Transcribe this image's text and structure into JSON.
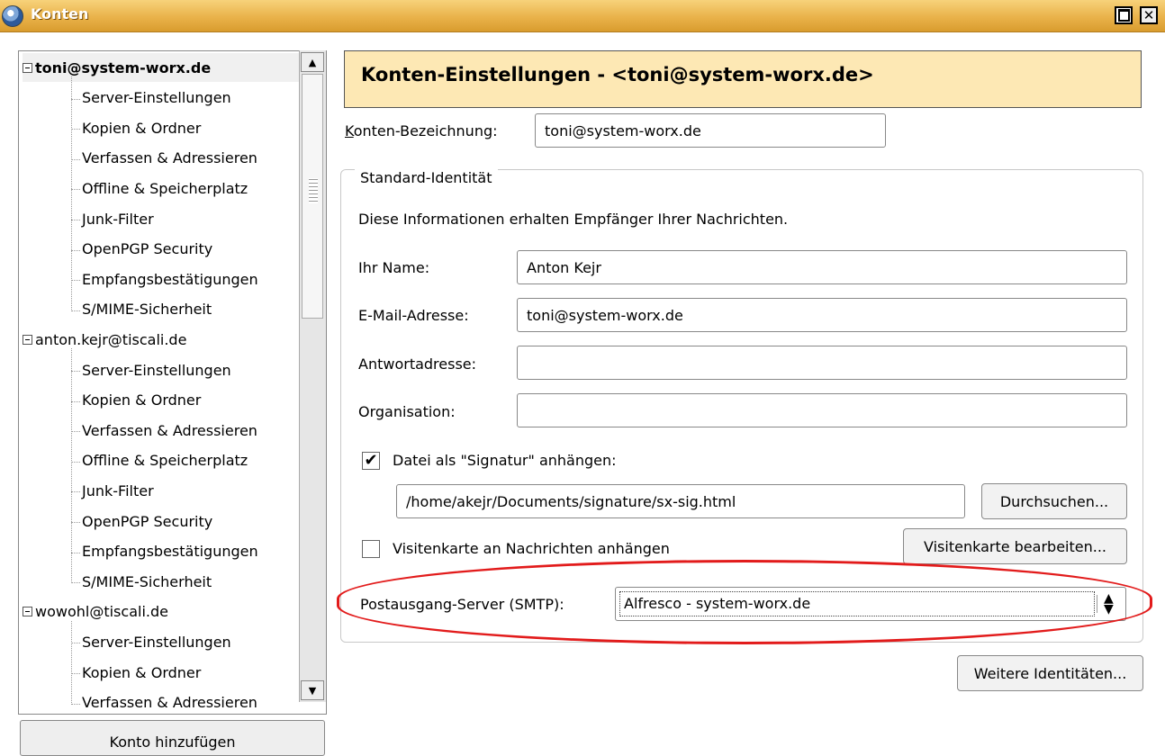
{
  "window": {
    "title": "Konten"
  },
  "tree": {
    "accounts": [
      {
        "name": "toni@system-worx.de",
        "selected": true,
        "children": [
          "Server-Einstellungen",
          "Kopien & Ordner",
          "Verfassen & Adressieren",
          "Offline & Speicherplatz",
          "Junk-Filter",
          "OpenPGP Security",
          "Empfangsbestätigungen",
          "S/MIME-Sicherheit"
        ]
      },
      {
        "name": "anton.kejr@tiscali.de",
        "selected": false,
        "children": [
          "Server-Einstellungen",
          "Kopien & Ordner",
          "Verfassen & Adressieren",
          "Offline & Speicherplatz",
          "Junk-Filter",
          "OpenPGP Security",
          "Empfangsbestätigungen",
          "S/MIME-Sicherheit"
        ]
      },
      {
        "name": "wowohl@tiscali.de",
        "selected": false,
        "children": [
          "Server-Einstellungen",
          "Kopien & Ordner",
          "Verfassen & Adressieren"
        ]
      }
    ],
    "add_account_label": "Konto hinzufügen"
  },
  "main": {
    "header": "Konten-Einstellungen - <toni@system-worx.de>",
    "account_name": {
      "label": "Konten-Bezeichnung:",
      "value": "toni@system-worx.de"
    },
    "identity": {
      "legend": "Standard-Identität",
      "info": "Diese Informationen erhalten Empfänger Ihrer Nachrichten.",
      "name": {
        "label": "Ihr Name:",
        "value": "Anton Kejr"
      },
      "email": {
        "label": "E-Mail-Adresse:",
        "value": "toni@system-worx.de"
      },
      "reply_to": {
        "label": "Antwortadresse:",
        "value": ""
      },
      "organization": {
        "label": "Organisation:",
        "value": ""
      },
      "signature": {
        "checked": true,
        "label": "Datei als \"Signatur\" anhängen:",
        "path": "/home/akejr/Documents/signature/sx-sig.html",
        "browse_label": "Durchsuchen..."
      },
      "vcard": {
        "checked": false,
        "label": "Visitenkarte an Nachrichten anhängen",
        "edit_label": "Visitenkarte bearbeiten..."
      },
      "smtp": {
        "label": "Postausgang-Server (SMTP):",
        "value": "Alfresco - system-worx.de"
      }
    },
    "more_identities_label": "Weitere Identitäten..."
  },
  "colors": {
    "header_bg": "#fde8b4",
    "titlebar": "#e9b24a",
    "highlight": "#e21b1b"
  }
}
